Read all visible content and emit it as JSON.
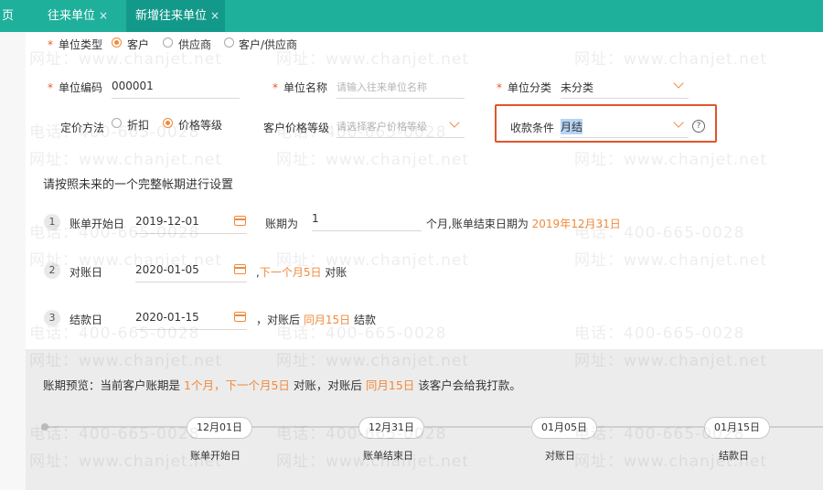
{
  "tabs": [
    {
      "label": "页"
    },
    {
      "label": "往来单位"
    },
    {
      "label": "新增往来单位"
    }
  ],
  "close_glyph": "×",
  "required_mark": "*",
  "form": {
    "unit_type": {
      "label": "单位类型",
      "options": [
        "客户",
        "供应商",
        "客户/供应商"
      ],
      "selected": "客户"
    },
    "unit_code": {
      "label": "单位编码",
      "value": "000001"
    },
    "unit_name": {
      "label": "单位名称",
      "placeholder": "请输入往来单位名称"
    },
    "unit_category": {
      "label": "单位分类",
      "value": "未分类"
    },
    "pricing_method": {
      "label": "定价方法",
      "options": [
        "折扣",
        "价格等级"
      ],
      "selected": "价格等级"
    },
    "customer_price_level": {
      "label": "客户价格等级",
      "placeholder": "请选择客户价格等级"
    },
    "payment_terms": {
      "label": "收款条件",
      "value": "月结",
      "help": "?"
    }
  },
  "period": {
    "instruction": "请按照未来的一个完整帐期进行设置",
    "steps": [
      {
        "num": "1",
        "label": "账单开始日",
        "date": "2019-12-01"
      },
      {
        "num": "2",
        "label": "对账日",
        "date": "2020-01-05"
      },
      {
        "num": "3",
        "label": "结款日",
        "date": "2020-01-15"
      }
    ],
    "period_label": "账期为",
    "period_value": "1",
    "period_suffix": "个月,账单结束日期为",
    "period_end": "2019年12月31日",
    "reconcile_prefix": ",",
    "reconcile_highlight": "下一个月5日",
    "reconcile_suffix": "对账",
    "settle_prefix": "，对账后",
    "settle_highlight": "同月15日",
    "settle_suffix": "结款"
  },
  "preview": {
    "prefix": "账期预览：当前客户账期是",
    "h1": "1个月，下一个月5日",
    "mid": "对账，对账后",
    "h2": "同月15日",
    "suffix": "该客户会给我打款。",
    "timeline": [
      {
        "date": "12月01日",
        "label": "账单开始日"
      },
      {
        "date": "12月31日",
        "label": "账单结束日"
      },
      {
        "date": "01月05日",
        "label": "对账日"
      },
      {
        "date": "01月15日",
        "label": "结款日"
      }
    ]
  },
  "watermark": {
    "phone": "电话：400-665-0028",
    "web": "网址：www.chanjet.net"
  },
  "colors": {
    "header": "#1fb09c",
    "accent": "#f08a3c",
    "highlight_box": "#e0552c"
  }
}
